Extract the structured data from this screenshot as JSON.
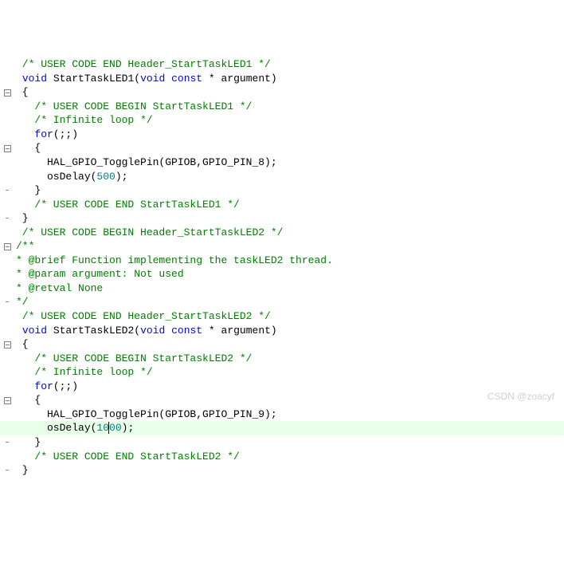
{
  "watermark": "CSDN @zoacyf",
  "lines": [
    {
      "gutter": "",
      "hl": false,
      "tokens": [
        {
          "cls": "c-comment",
          "t": " /* USER CODE END Header_StartTaskLED1 */"
        }
      ]
    },
    {
      "gutter": "",
      "hl": false,
      "tokens": [
        {
          "cls": "c-text",
          "t": " "
        },
        {
          "cls": "c-keyword",
          "t": "void"
        },
        {
          "cls": "c-text",
          "t": " StartTaskLED1("
        },
        {
          "cls": "c-keyword",
          "t": "void"
        },
        {
          "cls": "c-text",
          "t": " "
        },
        {
          "cls": "c-keyword",
          "t": "const"
        },
        {
          "cls": "c-text",
          "t": " * argument)"
        }
      ]
    },
    {
      "gutter": "fold",
      "hl": false,
      "tokens": [
        {
          "cls": "c-text",
          "t": " {"
        }
      ]
    },
    {
      "gutter": "",
      "hl": false,
      "tokens": [
        {
          "cls": "c-comment",
          "t": "   /* USER CODE BEGIN StartTaskLED1 */"
        }
      ]
    },
    {
      "gutter": "",
      "hl": false,
      "tokens": [
        {
          "cls": "c-comment",
          "t": "   /* Infinite loop */"
        }
      ]
    },
    {
      "gutter": "",
      "hl": false,
      "tokens": [
        {
          "cls": "c-text",
          "t": "   "
        },
        {
          "cls": "c-keyword",
          "t": "for"
        },
        {
          "cls": "c-text",
          "t": "(;;)"
        }
      ]
    },
    {
      "gutter": "fold",
      "hl": false,
      "tokens": [
        {
          "cls": "c-text",
          "t": "   {"
        }
      ]
    },
    {
      "gutter": "",
      "hl": false,
      "tokens": [
        {
          "cls": "c-text",
          "t": "     HAL_GPIO_TogglePin(GPIOB,GPIO_PIN_8);"
        }
      ]
    },
    {
      "gutter": "",
      "hl": false,
      "tokens": [
        {
          "cls": "c-text",
          "t": "     osDelay("
        },
        {
          "cls": "c-number",
          "t": "500"
        },
        {
          "cls": "c-text",
          "t": ");"
        }
      ]
    },
    {
      "gutter": "-",
      "hl": false,
      "tokens": [
        {
          "cls": "c-text",
          "t": "   }"
        }
      ]
    },
    {
      "gutter": "",
      "hl": false,
      "tokens": [
        {
          "cls": "c-comment",
          "t": "   /* USER CODE END StartTaskLED1 */"
        }
      ]
    },
    {
      "gutter": "-",
      "hl": false,
      "tokens": [
        {
          "cls": "c-text",
          "t": " }"
        }
      ]
    },
    {
      "gutter": "",
      "hl": false,
      "tokens": [
        {
          "cls": "c-text",
          "t": ""
        }
      ]
    },
    {
      "gutter": "",
      "hl": false,
      "tokens": [
        {
          "cls": "c-comment",
          "t": " /* USER CODE BEGIN Header_StartTaskLED2 */"
        }
      ]
    },
    {
      "gutter": "fold",
      "hl": false,
      "tokens": [
        {
          "cls": "c-comment",
          "t": "/**"
        }
      ]
    },
    {
      "gutter": "",
      "hl": false,
      "tokens": [
        {
          "cls": "c-comment",
          "t": "* @brief Function implementing the taskLED2 thread."
        }
      ]
    },
    {
      "gutter": "",
      "hl": false,
      "tokens": [
        {
          "cls": "c-comment",
          "t": "* @param argument: Not used"
        }
      ]
    },
    {
      "gutter": "",
      "hl": false,
      "tokens": [
        {
          "cls": "c-comment",
          "t": "* @retval None"
        }
      ]
    },
    {
      "gutter": "-",
      "hl": false,
      "tokens": [
        {
          "cls": "c-comment",
          "t": "*/"
        }
      ]
    },
    {
      "gutter": "",
      "hl": false,
      "tokens": [
        {
          "cls": "c-comment",
          "t": " /* USER CODE END Header_StartTaskLED2 */"
        }
      ]
    },
    {
      "gutter": "",
      "hl": false,
      "tokens": [
        {
          "cls": "c-text",
          "t": " "
        },
        {
          "cls": "c-keyword",
          "t": "void"
        },
        {
          "cls": "c-text",
          "t": " StartTaskLED2("
        },
        {
          "cls": "c-keyword",
          "t": "void"
        },
        {
          "cls": "c-text",
          "t": " "
        },
        {
          "cls": "c-keyword",
          "t": "const"
        },
        {
          "cls": "c-text",
          "t": " * argument)"
        }
      ]
    },
    {
      "gutter": "fold",
      "hl": false,
      "tokens": [
        {
          "cls": "c-text",
          "t": " {"
        }
      ]
    },
    {
      "gutter": "",
      "hl": false,
      "tokens": [
        {
          "cls": "c-comment",
          "t": "   /* USER CODE BEGIN StartTaskLED2 */"
        }
      ]
    },
    {
      "gutter": "",
      "hl": false,
      "tokens": [
        {
          "cls": "c-comment",
          "t": "   /* Infinite loop */"
        }
      ]
    },
    {
      "gutter": "",
      "hl": false,
      "tokens": [
        {
          "cls": "c-text",
          "t": "   "
        },
        {
          "cls": "c-keyword",
          "t": "for"
        },
        {
          "cls": "c-text",
          "t": "(;;)"
        }
      ]
    },
    {
      "gutter": "fold",
      "hl": false,
      "tokens": [
        {
          "cls": "c-text",
          "t": "   {"
        }
      ]
    },
    {
      "gutter": "",
      "hl": false,
      "tokens": [
        {
          "cls": "c-text",
          "t": "     HAL_GPIO_TogglePin(GPIOB,GPIO_PIN_9);"
        }
      ]
    },
    {
      "gutter": "",
      "hl": true,
      "tokens": [
        {
          "cls": "c-text",
          "t": "     osDelay("
        },
        {
          "cls": "c-number",
          "t": "10"
        },
        {
          "cls": "c-number",
          "t": "00",
          "cursor": true
        },
        {
          "cls": "c-text",
          "t": ");"
        }
      ]
    },
    {
      "gutter": "-",
      "hl": false,
      "tokens": [
        {
          "cls": "c-text",
          "t": "   }"
        }
      ]
    },
    {
      "gutter": "",
      "hl": false,
      "tokens": [
        {
          "cls": "c-comment",
          "t": "   /* USER CODE END StartTaskLED2 */"
        }
      ]
    },
    {
      "gutter": "-",
      "hl": false,
      "tokens": [
        {
          "cls": "c-text",
          "t": " }"
        }
      ]
    }
  ]
}
